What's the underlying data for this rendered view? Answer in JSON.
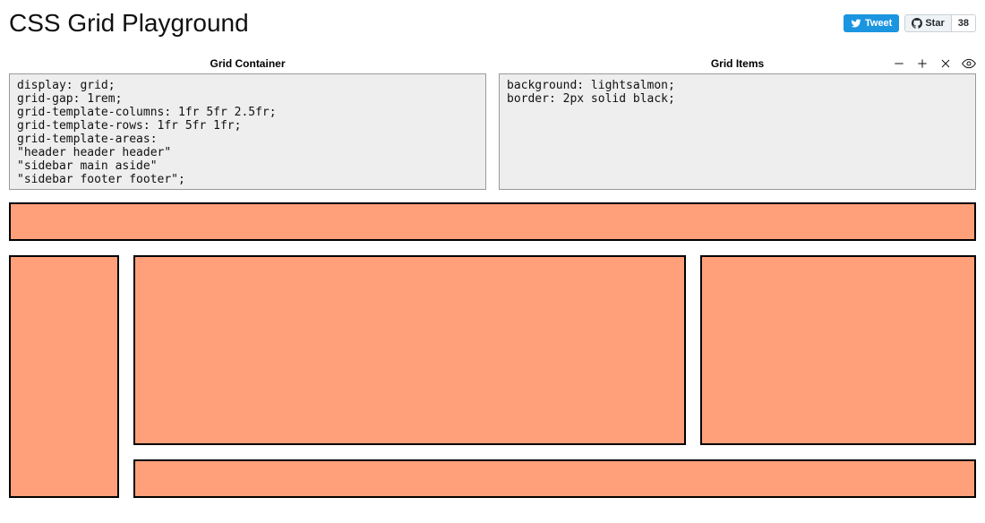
{
  "header": {
    "title": "CSS Grid Playground",
    "tweet_label": "Tweet",
    "star_label": "Star",
    "star_count": "38"
  },
  "editors": {
    "container": {
      "label": "Grid Container",
      "code": "display: grid;\ngrid-gap: 1rem;\ngrid-template-columns: 1fr 5fr 2.5fr;\ngrid-template-rows: 1fr 5fr 1fr;\ngrid-template-areas:\n\"header header header\"\n\"sidebar main aside\"\n\"sidebar footer footer\";"
    },
    "items": {
      "label": "Grid Items",
      "code": "background: lightsalmon;\nborder: 2px solid black;"
    }
  },
  "grid": {
    "areas": [
      "header",
      "sidebar",
      "main",
      "aside",
      "footer"
    ],
    "item_background": "lightsalmon",
    "item_border": "2px solid black",
    "gap": "1rem",
    "template_columns": "1fr 5fr 2.5fr",
    "template_rows": "1fr 5fr 1fr"
  }
}
